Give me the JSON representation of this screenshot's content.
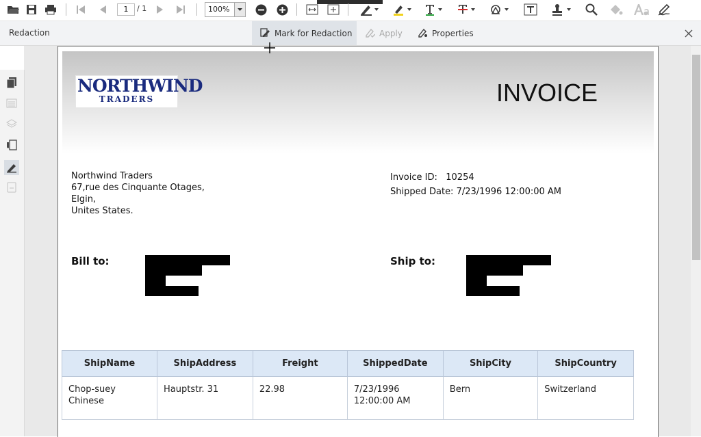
{
  "toolbar": {
    "page_number": "1",
    "page_total": "/ 1",
    "zoom": "100%",
    "icons": [
      "open-folder-icon",
      "save-icon",
      "print-icon",
      "first-page-icon",
      "previous-page-icon",
      "next-page-icon",
      "last-page-icon",
      "zoom-out-icon",
      "zoom-in-icon",
      "fit-width-icon",
      "fit-page-icon",
      "ink-icon",
      "highlight-icon",
      "text-markup-icon",
      "strikethrough-icon",
      "shape-icon",
      "free-text-icon",
      "stamp-icon",
      "search-icon",
      "fill-icon",
      "font-icon",
      "signature-icon"
    ]
  },
  "redaction_bar": {
    "title": "Redaction",
    "mark_label": "Mark for Redaction",
    "apply_label": "Apply",
    "properties_label": "Properties",
    "close_icon": "close-icon"
  },
  "sidebar": {
    "icons": [
      "pages-icon",
      "thumbnail-icon",
      "layers-icon",
      "bookmarks-icon",
      "redaction-icon",
      "attachments-icon"
    ]
  },
  "document": {
    "logo_line1": "NORTHWIND",
    "logo_line2": "TRADERS",
    "title": "INVOICE",
    "company_name": "Northwind Traders",
    "address_line1": "67,rue des Cinquante Otages,",
    "address_line2": "Elgin,",
    "address_line3": "Unites States.",
    "invoice_id_label": "Invoice ID:",
    "invoice_id": "10254",
    "shipped_date_label": "Shipped Date:",
    "shipped_date": "7/23/1996 12:00:00 AM",
    "bill_to_label": "Bill to:",
    "ship_to_label": "Ship to:",
    "table": {
      "headers": [
        "ShipName",
        "ShipAddress",
        "Freight",
        "ShippedDate",
        "ShipCity",
        "ShipCountry"
      ],
      "row": {
        "ship_name_1": "Chop-suey",
        "ship_name_2": "Chinese",
        "ship_address": "Hauptstr. 31",
        "freight": "22.98",
        "shipped_date_1": "7/23/1996",
        "shipped_date_2": "12:00:00 AM",
        "ship_city": "Bern",
        "ship_country": "Switzerland"
      }
    }
  },
  "colors": {
    "accent": "#1a2b7e",
    "table_header": "#dce8f6",
    "toolbar_icon": "#3c3c3c"
  }
}
